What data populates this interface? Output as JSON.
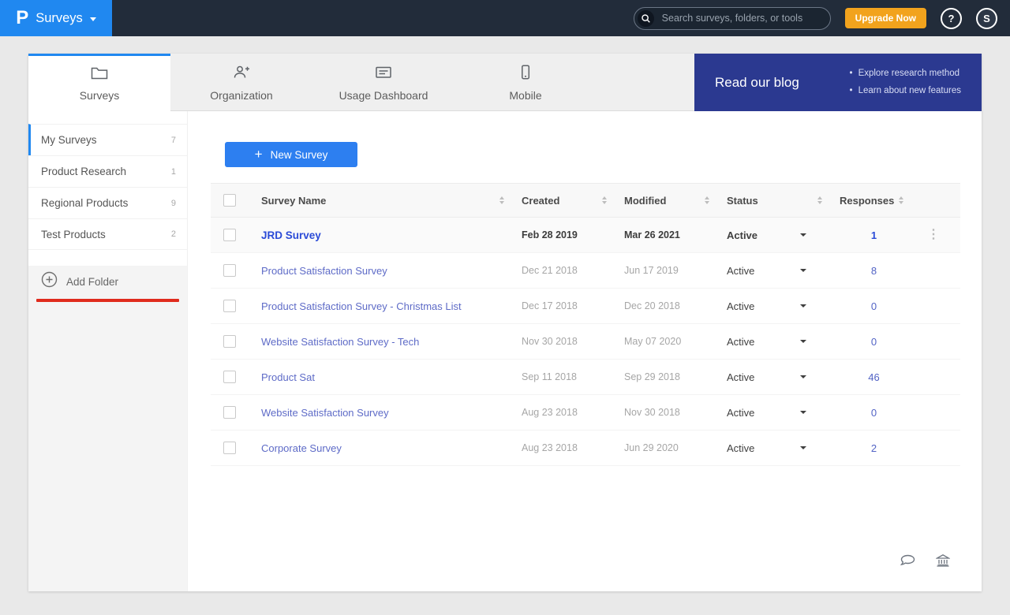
{
  "header": {
    "logo": "P",
    "product": "Surveys",
    "search_placeholder": "Search surveys, folders, or tools",
    "upgrade_label": "Upgrade Now",
    "help_label": "?",
    "avatar_initial": "S"
  },
  "tabs": [
    {
      "label": "Surveys",
      "icon": "folder-icon",
      "active": true
    },
    {
      "label": "Organization",
      "icon": "people-add-icon",
      "active": false
    },
    {
      "label": "Usage Dashboard",
      "icon": "dashboard-icon",
      "active": false
    },
    {
      "label": "Mobile",
      "icon": "mobile-icon",
      "active": false
    }
  ],
  "banner": {
    "title": "Read our blog",
    "bullets": [
      "Explore research method",
      "Learn about new features"
    ]
  },
  "sidebar": {
    "items": [
      {
        "label": "My Surveys",
        "count": "7",
        "active": true
      },
      {
        "label": "Product Research",
        "count": "1",
        "active": false
      },
      {
        "label": "Regional Products",
        "count": "9",
        "active": false
      },
      {
        "label": "Test Products",
        "count": "2",
        "active": false
      }
    ],
    "add_folder_label": "Add Folder"
  },
  "main": {
    "new_survey": {
      "plus": "+",
      "label": "New Survey"
    },
    "table": {
      "columns": [
        "Survey Name",
        "Created",
        "Modified",
        "Status",
        "Responses"
      ],
      "rows": [
        {
          "name": "JRD Survey",
          "created": "Feb 28 2019",
          "modified": "Mar 26 2021",
          "status": "Active",
          "responses": "1",
          "highlighted": true
        },
        {
          "name": "Product Satisfaction Survey",
          "created": "Dec 21 2018",
          "modified": "Jun 17 2019",
          "status": "Active",
          "responses": "8",
          "highlighted": false
        },
        {
          "name": "Product Satisfaction Survey - Christmas List",
          "created": "Dec 17 2018",
          "modified": "Dec 20 2018",
          "status": "Active",
          "responses": "0",
          "highlighted": false
        },
        {
          "name": "Website Satisfaction Survey - Tech",
          "created": "Nov 30 2018",
          "modified": "May 07 2020",
          "status": "Active",
          "responses": "0",
          "highlighted": false
        },
        {
          "name": "Product Sat",
          "created": "Sep 11 2018",
          "modified": "Sep 29 2018",
          "status": "Active",
          "responses": "46",
          "highlighted": false
        },
        {
          "name": "Website Satisfaction Survey",
          "created": "Aug 23 2018",
          "modified": "Nov 30 2018",
          "status": "Active",
          "responses": "0",
          "highlighted": false
        },
        {
          "name": "Corporate Survey",
          "created": "Aug 23 2018",
          "modified": "Jun 29 2020",
          "status": "Active",
          "responses": "2",
          "highlighted": false
        }
      ],
      "row_menu_glyph": "⋮"
    }
  },
  "colors": {
    "topbar": "#222c3a",
    "accent_blue": "#2088f0",
    "button_blue": "#2d7ff0",
    "banner_indigo": "#2b3990",
    "upgrade_orange": "#f2a31d",
    "annotation_red": "#e02b1d",
    "link_indigo": "#5e6bc7",
    "highlight_link_blue": "#2b4bd7"
  }
}
